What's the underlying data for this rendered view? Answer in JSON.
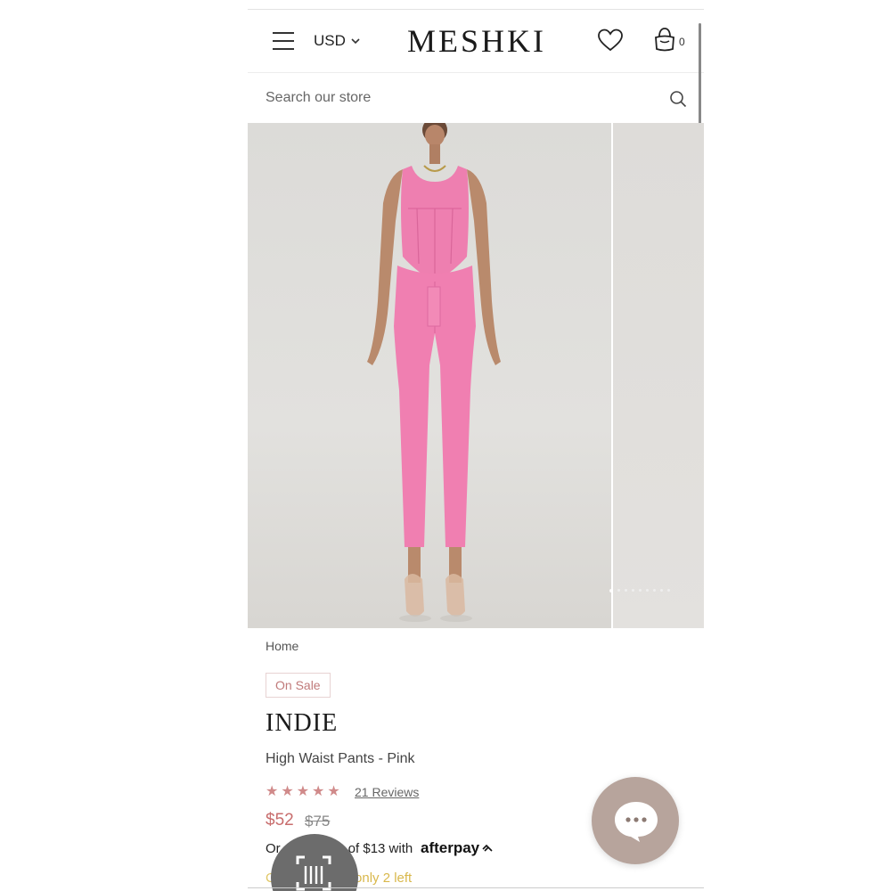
{
  "header": {
    "currency": "USD",
    "logo": "MESHKI",
    "cart_count": "0"
  },
  "search": {
    "placeholder": "Search our store"
  },
  "gallery": {
    "slide_count": 9,
    "active_slide": 1,
    "image_alt": "Model wearing pink corset top and high waist pants"
  },
  "product": {
    "breadcrumb": "Home",
    "badge": "On Sale",
    "title": "INDIE",
    "subtitle": "High Waist Pants - Pink",
    "rating": 5,
    "reviews_label": "21 Reviews",
    "price": "$52",
    "compare_price": "$75",
    "installment_prefix": "Or",
    "installment_amount": "of $13 with",
    "afterpay_label": "afterpay",
    "stock_prefix": "C",
    "stock_text": "- only 2 left"
  },
  "colors": {
    "accent": "#c86d6d",
    "product_pink": "#f07fb1",
    "chat_button": "#b7a49c"
  }
}
